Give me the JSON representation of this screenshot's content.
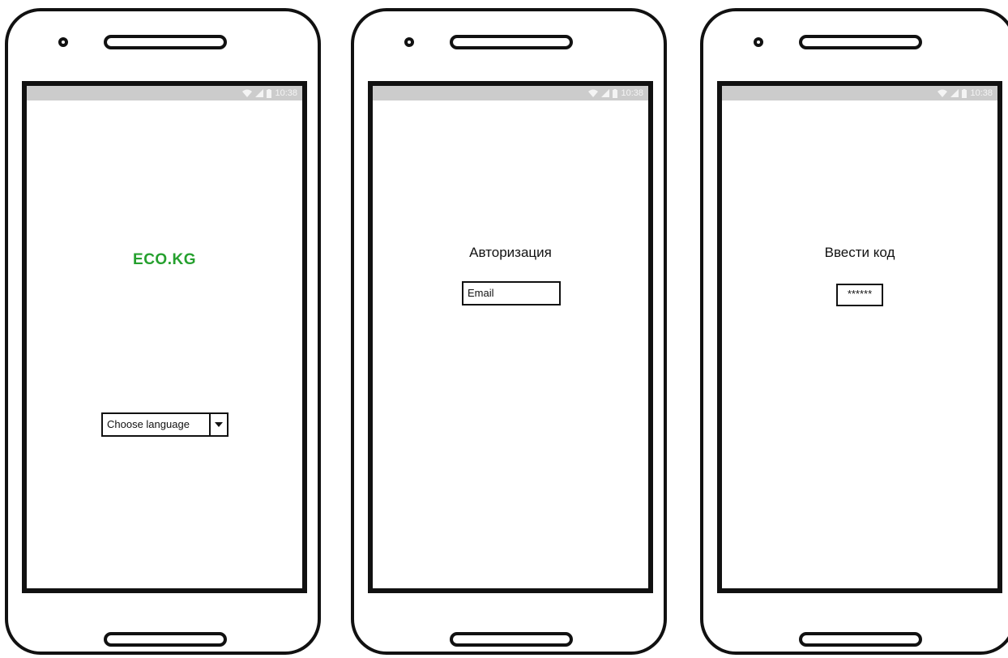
{
  "status_bar": {
    "time": "10:38"
  },
  "screens": [
    {
      "app_title": "ECO.KG",
      "language_select": {
        "placeholder": "Choose language"
      }
    },
    {
      "title": "Авторизация",
      "email_input": {
        "placeholder": "Email"
      }
    },
    {
      "title": "Ввести код",
      "code_input": {
        "value": "******"
      }
    }
  ],
  "colors": {
    "brand": "#25a02e",
    "status_bar": "#cccccc"
  },
  "icons": [
    "wifi-icon",
    "signal-icon",
    "battery-icon",
    "dropdown-arrow-icon"
  ]
}
